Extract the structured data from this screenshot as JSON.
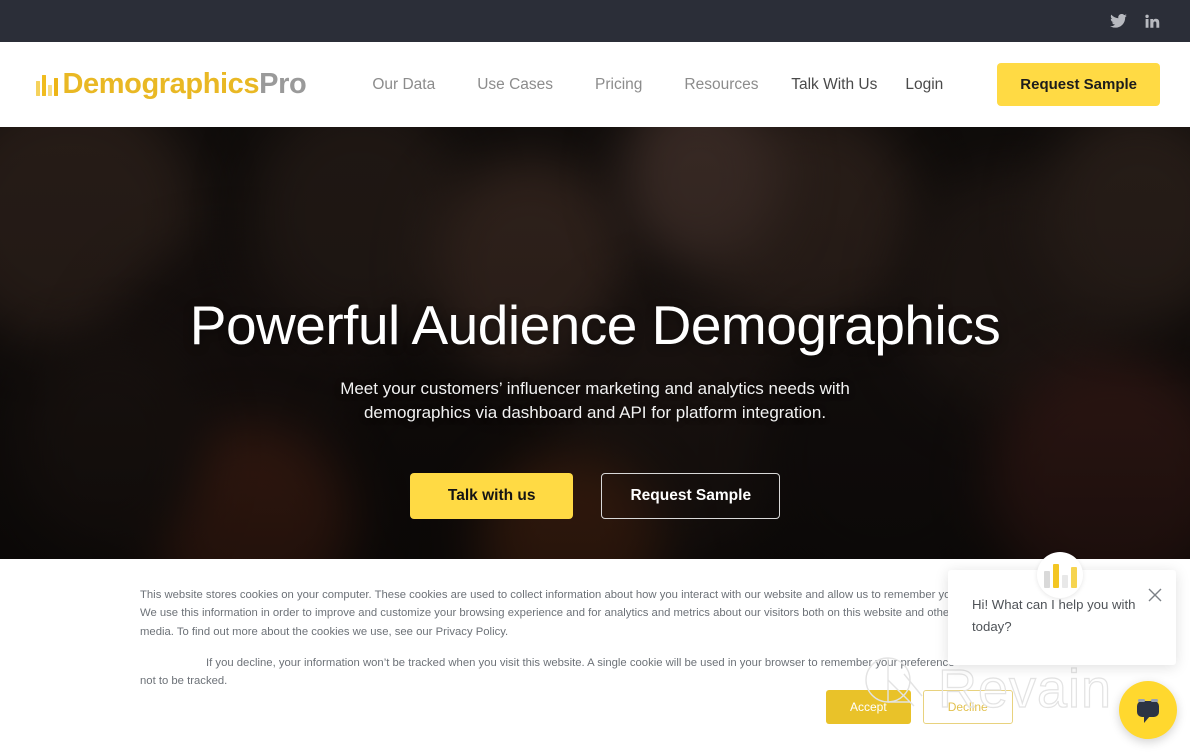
{
  "topbar": {
    "social": [
      {
        "name": "twitter-icon",
        "label": "Twitter"
      },
      {
        "name": "linkedin-icon",
        "label": "LinkedIn"
      }
    ]
  },
  "header": {
    "logo": {
      "part_a": "Demographics",
      "part_b": "Pro",
      "icon": "bar-chart-icon"
    },
    "nav": [
      {
        "label": "Our Data"
      },
      {
        "label": "Use Cases"
      },
      {
        "label": "Pricing"
      },
      {
        "label": "Resources"
      }
    ],
    "util": [
      {
        "label": "Talk With Us"
      },
      {
        "label": "Login"
      }
    ],
    "cta_label": "Request Sample"
  },
  "hero": {
    "title": "Powerful Audience Demographics",
    "subtitle_line1": "Meet your customers’ influencer marketing and analytics needs with",
    "subtitle_line2": "demographics via dashboard and API for platform integration.",
    "primary_cta": "Talk with us",
    "secondary_cta": "Request Sample"
  },
  "cookie": {
    "paragraph1": "This website stores cookies on your computer. These cookies are used to collect information about how you interact with our website and allow us to remember you. We use this information in order to improve and customize your browsing experience and for analytics and metrics about our visitors both on this website and other media. To find out more about the cookies we use, see our Privacy Policy.",
    "paragraph2": "If you decline, your information won’t be tracked when you visit this website. A single cookie will be used in your browser to remember your preference not to be tracked.",
    "accept_label": "Accept",
    "decline_label": "Decline"
  },
  "chat": {
    "message": "Hi! What can I help you with today?",
    "close_icon": "close-icon",
    "avatar_icon": "bar-chart-avatar-icon",
    "fab_icon": "chat-bubble-icon"
  },
  "watermark": {
    "text": "Revain"
  },
  "colors": {
    "brand_yellow": "#ffda44",
    "logo_gold": "#e9b824",
    "topbar_dark": "#2b2e38",
    "nav_gray": "#8c8c8c",
    "chat_fab": "#ffd82e"
  }
}
